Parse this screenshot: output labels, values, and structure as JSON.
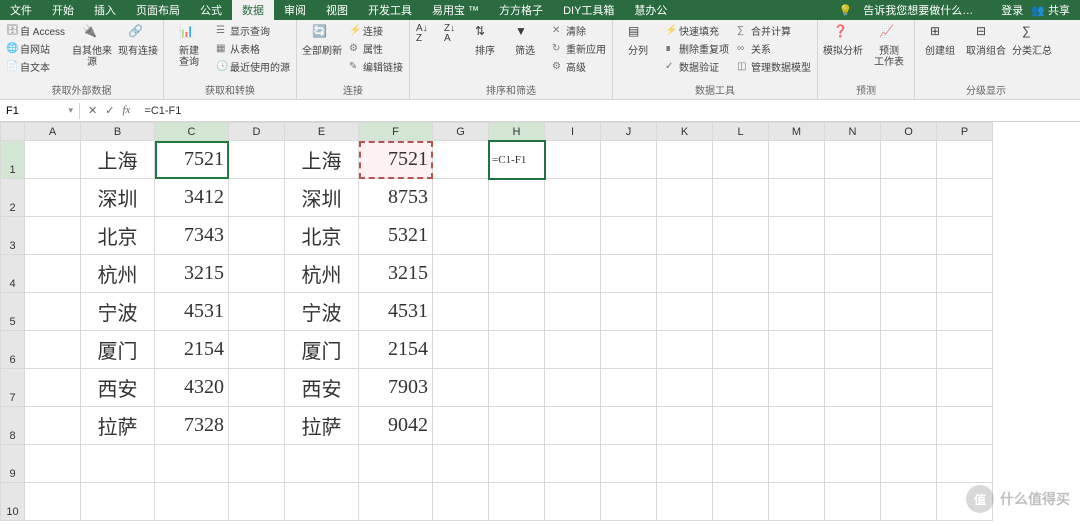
{
  "menubar": {
    "tabs": [
      "文件",
      "开始",
      "插入",
      "页面布局",
      "公式",
      "数据",
      "审阅",
      "视图",
      "开发工具",
      "易用宝 ™",
      "方方格子",
      "DIY工具箱",
      "慧办公"
    ],
    "active_index": 5,
    "tell_me": "告诉我您想要做什么…",
    "login": "登录",
    "share": "共享"
  },
  "ribbon": {
    "g1": {
      "title": "获取外部数据",
      "items": [
        "自 Access",
        "自网站",
        "自文本"
      ],
      "btn1": "自其他来源",
      "btn2": "现有连接"
    },
    "g2": {
      "title": "获取和转换",
      "btn1": "新建\n查询",
      "items": [
        "显示查询",
        "从表格",
        "最近使用的源"
      ]
    },
    "g3": {
      "title": "连接",
      "btn1": "全部刷新",
      "items": [
        "连接",
        "属性",
        "编辑链接"
      ]
    },
    "g4": {
      "title": "排序和筛选",
      "btn1": "排序",
      "btn2": "筛选",
      "items": [
        "清除",
        "重新应用",
        "高级"
      ]
    },
    "g5": {
      "title": "数据工具",
      "btn1": "分列",
      "items": [
        "快速填充",
        "删除重复项",
        "数据验证"
      ],
      "items2": [
        "合并计算",
        "关系",
        "管理数据模型"
      ]
    },
    "g6": {
      "title": "预测",
      "btn1": "模拟分析",
      "btn2": "预测\n工作表"
    },
    "g7": {
      "title": "分级显示",
      "btn1": "创建组",
      "btn2": "取消组合",
      "btn3": "分类汇总"
    }
  },
  "formula_bar": {
    "namebox": "F1",
    "formula": "=C1-F1"
  },
  "grid": {
    "columns": [
      "A",
      "B",
      "C",
      "D",
      "E",
      "F",
      "G",
      "H",
      "I",
      "J",
      "K",
      "L",
      "M",
      "N",
      "O",
      "P"
    ],
    "row_count": 10,
    "wide_cols": [
      "B",
      "C",
      "E",
      "F"
    ],
    "data": {
      "B": [
        "上海",
        "深圳",
        "北京",
        "杭州",
        "宁波",
        "厦门",
        "西安",
        "拉萨"
      ],
      "C": [
        "7521",
        "3412",
        "7343",
        "3215",
        "4531",
        "2154",
        "4320",
        "7328"
      ],
      "E": [
        "上海",
        "深圳",
        "北京",
        "杭州",
        "宁波",
        "厦门",
        "西安",
        "拉萨"
      ],
      "F": [
        "7521",
        "8753",
        "5321",
        "3215",
        "4531",
        "2154",
        "7903",
        "9042"
      ]
    },
    "editing_cell": {
      "col": "H",
      "row": 1,
      "value": "=C1-F1"
    },
    "source_cell": {
      "col": "C",
      "row": 1
    },
    "dashed_cell": {
      "col": "F",
      "row": 1
    }
  },
  "watermark": "什么值得买"
}
